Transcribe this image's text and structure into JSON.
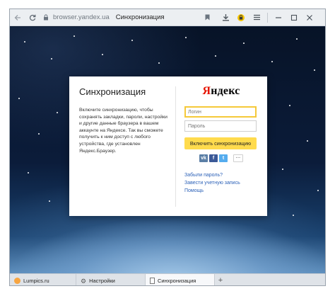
{
  "browser": {
    "address_host": "browser.yandex.ua",
    "page_title": "Синхронизация",
    "icons": {
      "back": "back-arrow-icon",
      "reload": "reload-icon",
      "lock": "lock-icon",
      "bookmark": "bookmark-icon",
      "download": "download-icon",
      "extension": "extension-icon",
      "menu": "menu-icon",
      "minimize": "minimize-icon",
      "maximize": "maximize-icon",
      "close": "close-icon"
    }
  },
  "sync": {
    "title": "Синхронизация",
    "description": "Включите синхронизацию, чтобы сохранять закладки, пароли, настройки и другие данные браузера в вашем аккаунте на Яндексе. Так вы сможете получить к ним доступ с любого устройства, где установлен Яндекс.Браузер.",
    "logo_first": "Я",
    "logo_rest": "ндекс",
    "login_placeholder": "Логин",
    "password_placeholder": "Пароль",
    "sync_button": "Включить синхронизацию",
    "social": {
      "vk": "vk",
      "fb": "f",
      "tw": "t",
      "more": "···"
    },
    "links": {
      "forgot": "Забыли пароль?",
      "register": "Завести учетную запись",
      "help": "Помощь"
    }
  },
  "tabs": [
    {
      "label": "Lumpics.ru"
    },
    {
      "label": "Настройки"
    },
    {
      "label": "Синхронизация"
    }
  ],
  "new_tab": "+",
  "colors": {
    "accent_yellow": "#ffdb4d",
    "focus_border": "#f5c93a",
    "link_blue": "#2d62b8",
    "logo_red": "#e61400"
  }
}
